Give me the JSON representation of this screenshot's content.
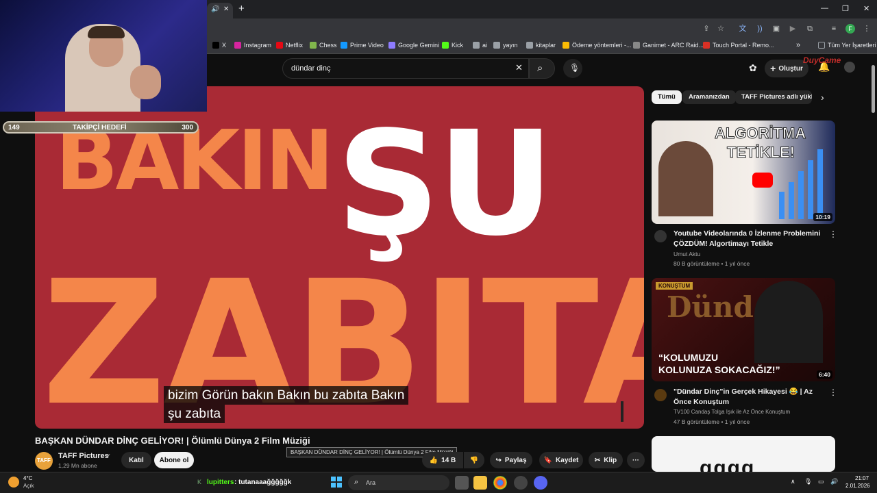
{
  "browser": {
    "tab_close": "✕",
    "new_tab": "+",
    "bookmarks": [
      {
        "label": "X",
        "color": "#000000"
      },
      {
        "label": "Instagram",
        "color": "#d6249f"
      },
      {
        "label": "Netflix",
        "color": "#e50914"
      },
      {
        "label": "Chess",
        "color": "#81b64c"
      },
      {
        "label": "Prime Video",
        "color": "#1399ff"
      },
      {
        "label": "Google Gemini",
        "color": "#8e7cff"
      },
      {
        "label": "Kick",
        "color": "#53fc18"
      },
      {
        "label": "ai",
        "color": "#9aa0a6"
      },
      {
        "label": "yayın",
        "color": "#9aa0a6"
      },
      {
        "label": "kitaplar",
        "color": "#9aa0a6"
      },
      {
        "label": "Ödeme yöntemleri -...",
        "color": "#fbbc04"
      },
      {
        "label": "Ganimet - ARC Raid...",
        "color": "#888888"
      },
      {
        "label": "Touch Portal - Remo...",
        "color": "#d93025"
      }
    ],
    "all_bookmarks": "Tüm Yer İşaretleri",
    "more_bookmarks": "»",
    "profile_initial": "F"
  },
  "youtube": {
    "search_value": "dündar dinç",
    "create_label": "Oluştur",
    "logo_overlay": "DuyCame"
  },
  "video": {
    "thumb_word1": "BAKIN",
    "thumb_word2": "ŞU",
    "thumb_word3": "ZABITA",
    "caption_line1": "bizim Görün bakın Bakın bu zabıta Bakın",
    "caption_line2": "şu zabıta",
    "title": "BAŞKAN DÜNDAR DİNÇ GELİYOR! | Ölümlü Dünya 2 Film Müziği",
    "tooltip": "BAŞKAN DÜNDAR DİNÇ GELİYOR!  | Ölümlü Dünya 2 Film Müziği",
    "channel_name": "TAFF Pictures",
    "channel_logo": "TAFF",
    "subscribers": "1,29 Mn abone",
    "join_label": "Katıl",
    "subscribe_label": "Abone ol",
    "likes": "14 B",
    "share_label": "Paylaş",
    "save_label": "Kaydet",
    "clip_label": "Klip",
    "more": "···"
  },
  "sidebar": {
    "chips": [
      "Tümü",
      "Aramanızdan",
      "TAFF Pictures adlı yükle"
    ],
    "videos": [
      {
        "thumb_line1": "ALGORİTMA",
        "thumb_line2": "TETİKLE!",
        "duration": "10:19",
        "title": "Youtube Videolarında 0 İzlenme Problemini ÇÖZDÜM! Algortimayı Tetikle",
        "channel": "Umut Aktu",
        "meta": "80 B görüntüleme • 1 yıl önce"
      },
      {
        "thumb_badge": "KONUŞTUM",
        "thumb_name": "Dünd",
        "thumb_quote1": "“KOLUMUZU",
        "thumb_quote2": "KOLUNUZA SOKACAĞIZ!”",
        "duration": "6:40",
        "title": "\"Dündar Dinç\"in Gerçek Hikayesi 😂 | Az Önce Konuştum",
        "channel": "TV100 Candaş Tolga Işık ile Az Önce Konuştum",
        "meta": "47 B görüntüleme • 1 yıl önce"
      }
    ]
  },
  "stream_overlay": {
    "goal_current": "149",
    "goal_label": "TAKİPÇİ HEDEFİ",
    "goal_target": "300",
    "chat_user": "lupitters",
    "chat_message": ": tutanaaağğğğğk"
  },
  "taskbar": {
    "weather_temp": "4°C",
    "weather_desc": "Açık",
    "search_placeholder": "Ara",
    "time": "21:07",
    "date": "2.01.2026"
  },
  "colors": {
    "video_bg": "#a92a35",
    "thumb_orange": "#f4864a",
    "accent_red": "#ff0000"
  }
}
